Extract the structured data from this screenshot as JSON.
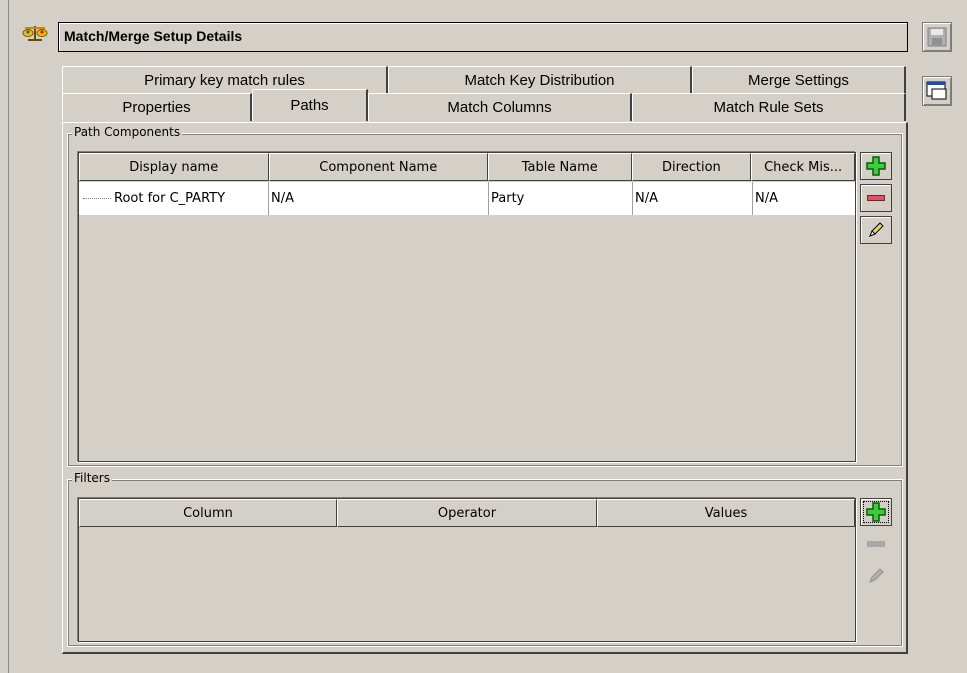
{
  "header": {
    "title": "Match/Merge Setup Details",
    "icon": "scales-icon"
  },
  "side_buttons": [
    {
      "name": "save-icon"
    },
    {
      "name": "dialog-icon"
    }
  ],
  "tabs": {
    "row_top": [
      "Primary key match rules",
      "Match Key Distribution",
      "Merge Settings"
    ],
    "row_bottom": [
      "Properties",
      "Paths",
      "Match Columns",
      "Match Rule Sets"
    ],
    "active": "Paths"
  },
  "path_components": {
    "legend": "Path Components",
    "columns": [
      "Display name",
      "Component Name",
      "Table Name",
      "Direction",
      "Check Mis..."
    ],
    "rows": [
      [
        "Root for C_PARTY",
        "N/A",
        "Party",
        "N/A",
        "N/A"
      ]
    ]
  },
  "filters": {
    "legend": "Filters",
    "columns": [
      "Column",
      "Operator",
      "Values"
    ],
    "rows": []
  },
  "colors": {
    "background": "#d4d0c8",
    "add_green": "#2fb82f",
    "remove_red": "#e0506a"
  }
}
